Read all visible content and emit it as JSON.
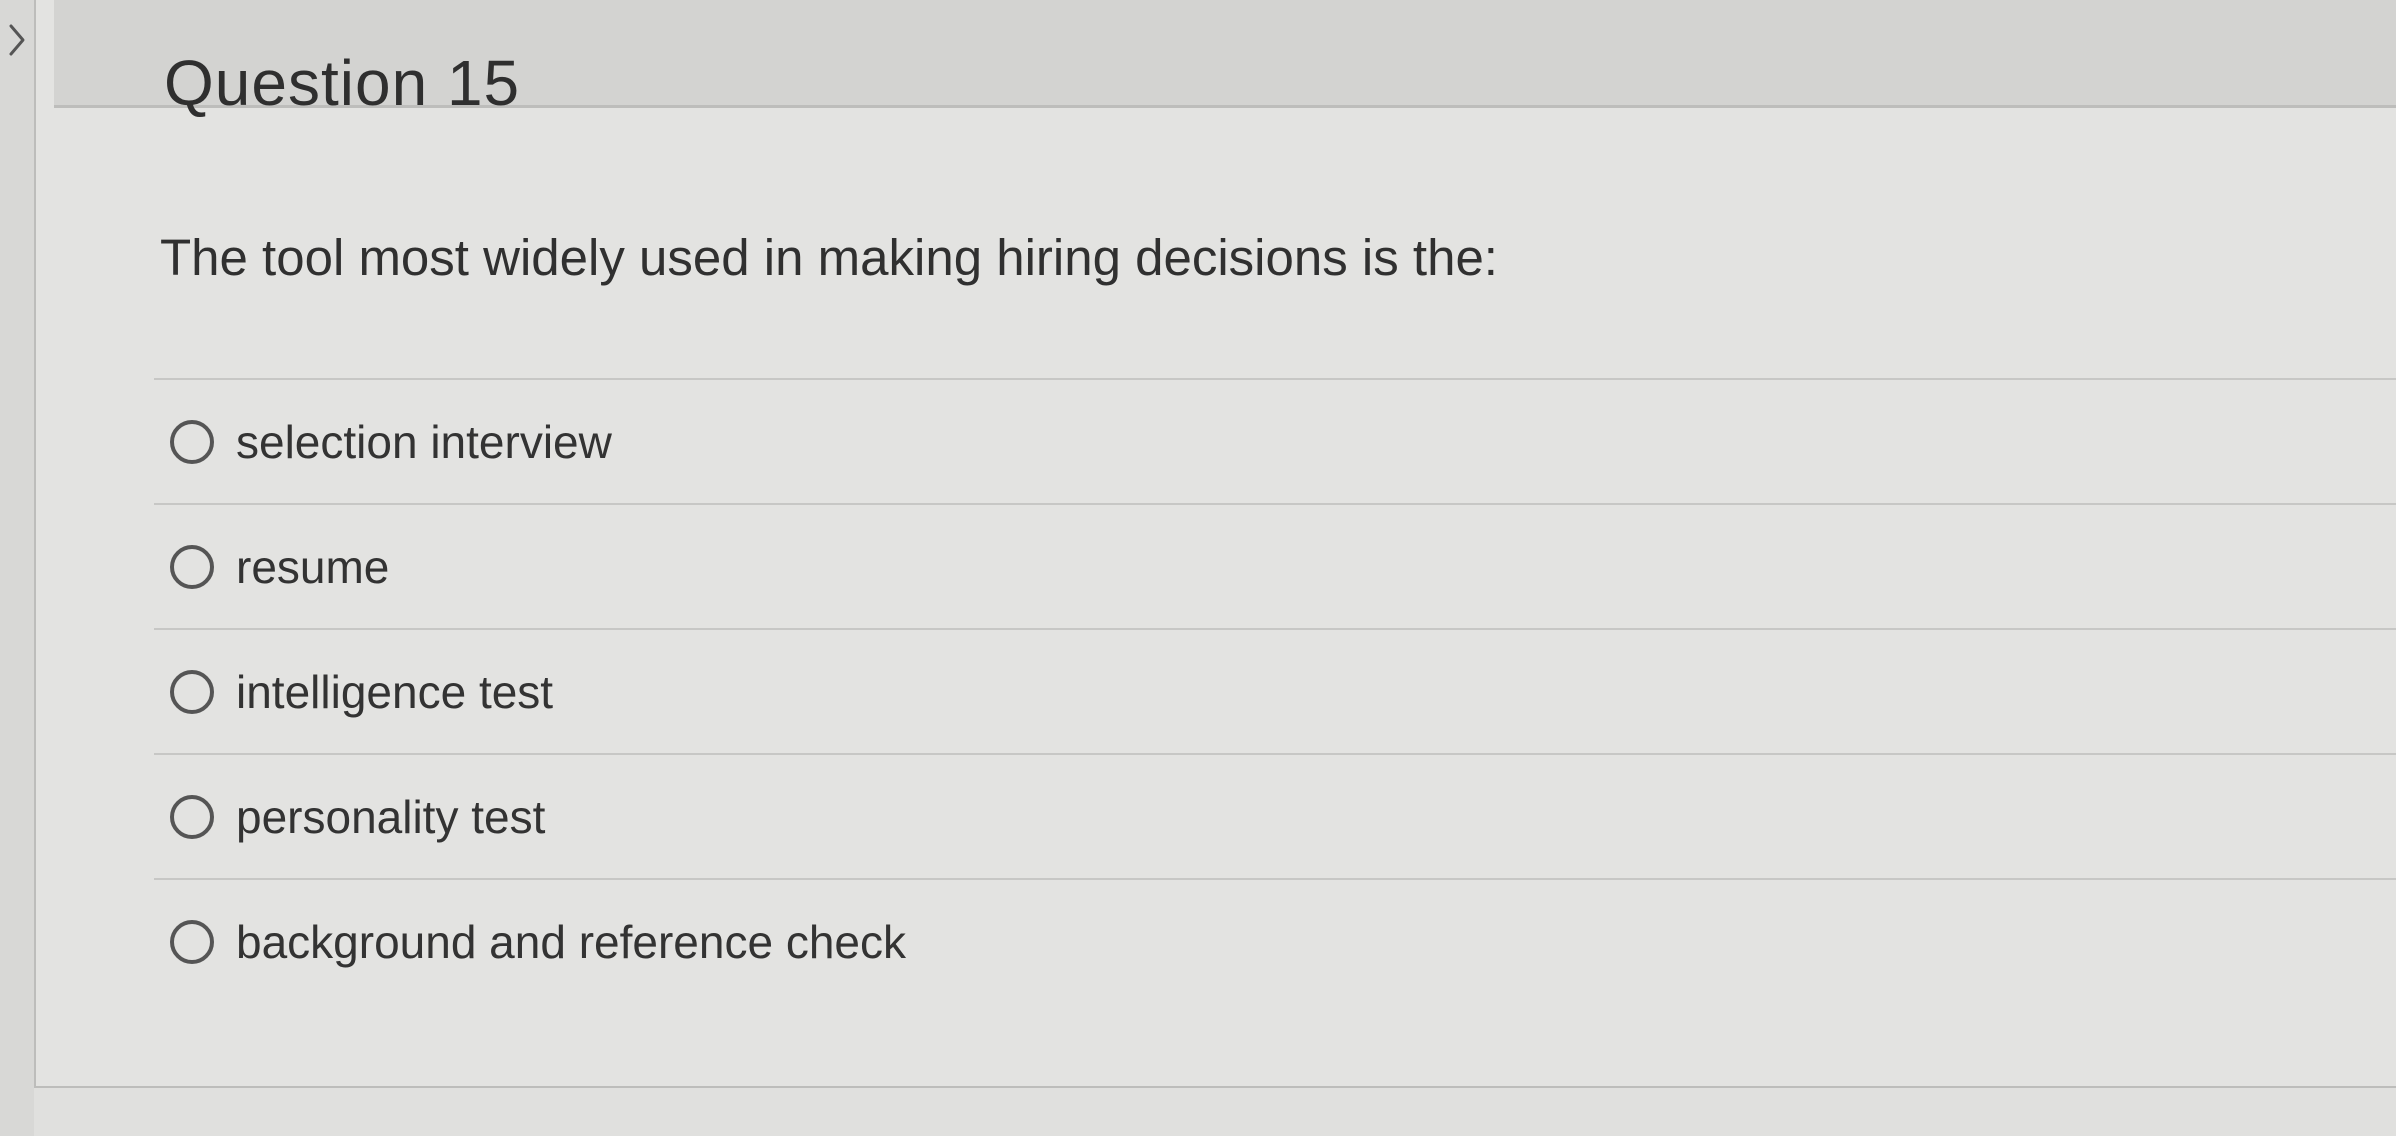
{
  "question": {
    "title": "Question 15",
    "text": "The tool most widely used in making hiring decisions is the:",
    "answers": [
      {
        "label": "selection interview",
        "selected": false
      },
      {
        "label": "resume",
        "selected": false
      },
      {
        "label": "intelligence test",
        "selected": false
      },
      {
        "label": "personality test",
        "selected": false
      },
      {
        "label": "background and reference check",
        "selected": false
      }
    ]
  },
  "icons": {
    "collapse": "chevron-right-icon",
    "radio": "radio-unselected-icon"
  },
  "colors": {
    "background": "#e3e3e1",
    "header": "#d3d3d1",
    "divider": "#c7c7c5",
    "text": "#333333"
  }
}
